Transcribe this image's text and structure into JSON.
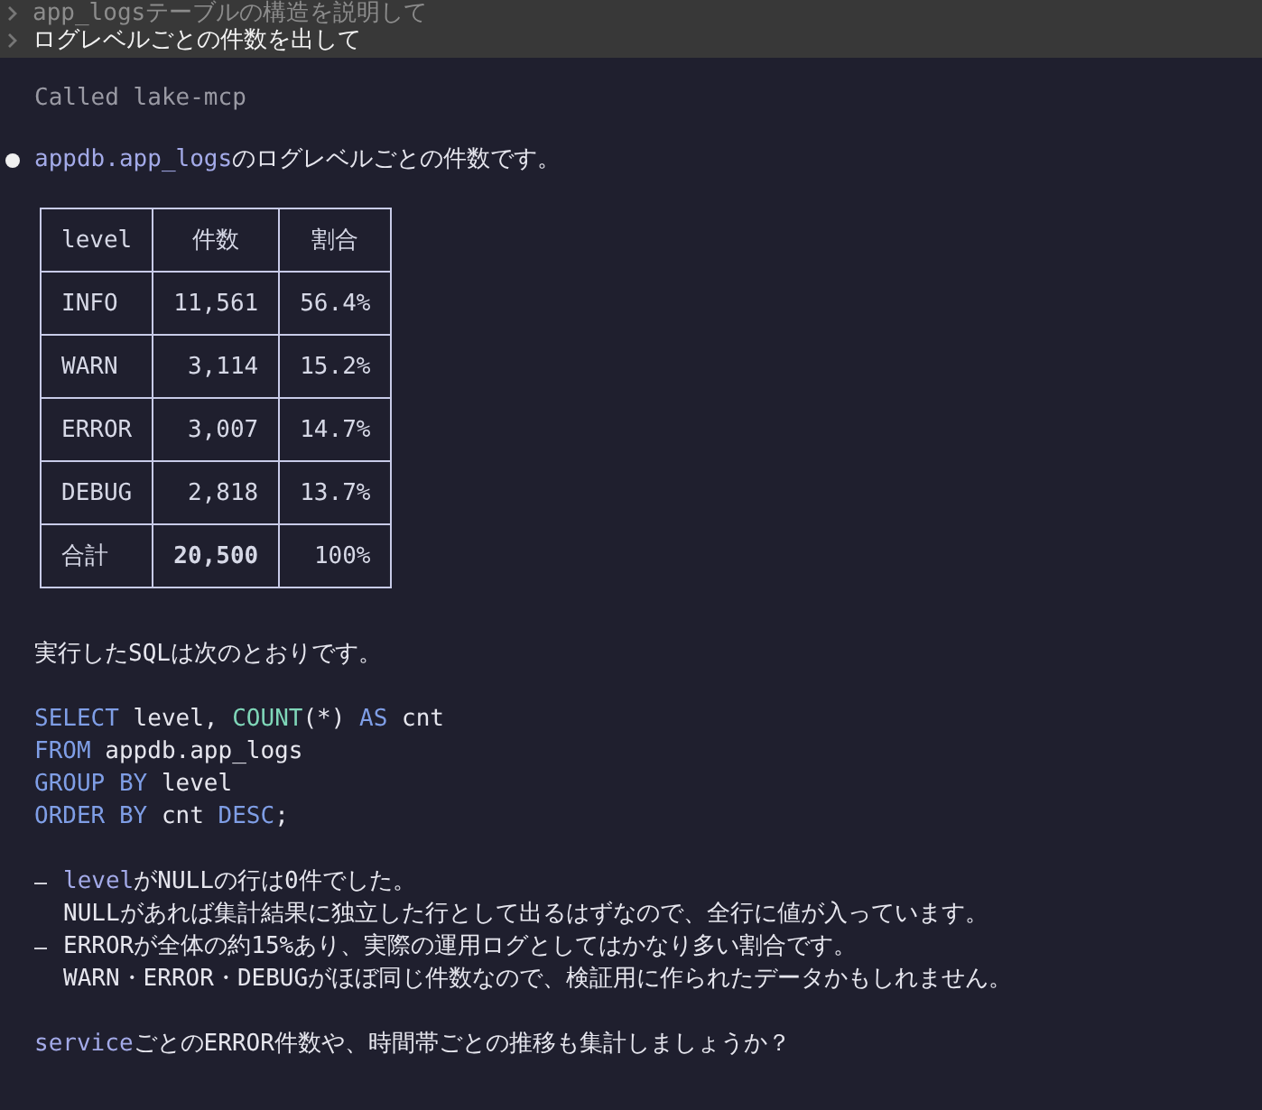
{
  "history": [
    {
      "text": "app_logsテーブルの構造を説明して",
      "selected": false
    },
    {
      "text": "ログレベルごとの件数を出して",
      "selected": true
    }
  ],
  "tool_call": "Called lake-mcp",
  "answer_intro": [
    {
      "text": "appdb.app_logs",
      "kind": "code"
    },
    {
      "text": "のログレベルごとの件数です。",
      "kind": "plain"
    }
  ],
  "table": {
    "columns": [
      "level",
      "件数",
      "割合"
    ],
    "rows": [
      {
        "cells": [
          "INFO",
          "11,561",
          "56.4%"
        ],
        "kind": "data"
      },
      {
        "cells": [
          "WARN",
          "3,114",
          "15.2%"
        ],
        "kind": "data"
      },
      {
        "cells": [
          "ERROR",
          "3,007",
          "14.7%"
        ],
        "kind": "data"
      },
      {
        "cells": [
          "DEBUG",
          "2,818",
          "13.7%"
        ],
        "kind": "data"
      },
      {
        "cells": [
          "合計",
          "20,500",
          "100%"
        ],
        "kind": "total"
      }
    ]
  },
  "sql_intro": "実行したSQLは次のとおりです。",
  "sql_lines": [
    [
      {
        "text": "SELECT",
        "kind": "keyword"
      },
      {
        "text": " level, ",
        "kind": "plain"
      },
      {
        "text": "COUNT",
        "kind": "function"
      },
      {
        "text": "(*) ",
        "kind": "plain"
      },
      {
        "text": "AS",
        "kind": "keyword"
      },
      {
        "text": " cnt",
        "kind": "plain"
      }
    ],
    [
      {
        "text": "FROM",
        "kind": "keyword"
      },
      {
        "text": " appdb.app_logs",
        "kind": "plain"
      }
    ],
    [
      {
        "text": "GROUP BY",
        "kind": "keyword"
      },
      {
        "text": " level",
        "kind": "plain"
      }
    ],
    [
      {
        "text": "ORDER BY",
        "kind": "keyword"
      },
      {
        "text": " cnt ",
        "kind": "plain"
      },
      {
        "text": "DESC",
        "kind": "keyword"
      },
      {
        "text": ";",
        "kind": "plain"
      }
    ]
  ],
  "notes": [
    {
      "lines": [
        [
          {
            "text": "level",
            "kind": "code"
          },
          {
            "text": "がNULLの行は0件でした。",
            "kind": "plain"
          }
        ],
        [
          {
            "text": "NULLがあれば集計結果に独立した行として出るはずなので、全行に値が入っています。",
            "kind": "plain"
          }
        ]
      ]
    },
    {
      "lines": [
        [
          {
            "text": "ERRORが全体の約15%あり、実際の運用ログとしてはかなり多い割合です。",
            "kind": "plain"
          }
        ],
        [
          {
            "text": "WARN・ERROR・DEBUGがほぼ同じ件数なので、検証用に作られたデータかもしれません。",
            "kind": "plain"
          }
        ]
      ]
    }
  ],
  "closing": [
    {
      "text": "service",
      "kind": "code"
    },
    {
      "text": "ごとのERROR件数や、時間帯ごとの推移も集計しましょうか？",
      "kind": "plain"
    }
  ]
}
